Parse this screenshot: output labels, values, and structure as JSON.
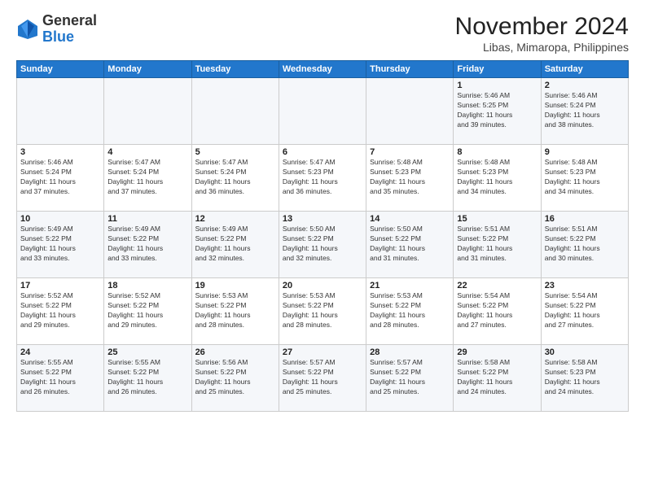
{
  "logo": {
    "general": "General",
    "blue": "Blue"
  },
  "header": {
    "month": "November 2024",
    "location": "Libas, Mimaropa, Philippines"
  },
  "weekdays": [
    "Sunday",
    "Monday",
    "Tuesday",
    "Wednesday",
    "Thursday",
    "Friday",
    "Saturday"
  ],
  "weeks": [
    [
      {
        "day": "",
        "info": ""
      },
      {
        "day": "",
        "info": ""
      },
      {
        "day": "",
        "info": ""
      },
      {
        "day": "",
        "info": ""
      },
      {
        "day": "",
        "info": ""
      },
      {
        "day": "1",
        "info": "Sunrise: 5:46 AM\nSunset: 5:25 PM\nDaylight: 11 hours\nand 39 minutes."
      },
      {
        "day": "2",
        "info": "Sunrise: 5:46 AM\nSunset: 5:24 PM\nDaylight: 11 hours\nand 38 minutes."
      }
    ],
    [
      {
        "day": "3",
        "info": "Sunrise: 5:46 AM\nSunset: 5:24 PM\nDaylight: 11 hours\nand 37 minutes."
      },
      {
        "day": "4",
        "info": "Sunrise: 5:47 AM\nSunset: 5:24 PM\nDaylight: 11 hours\nand 37 minutes."
      },
      {
        "day": "5",
        "info": "Sunrise: 5:47 AM\nSunset: 5:24 PM\nDaylight: 11 hours\nand 36 minutes."
      },
      {
        "day": "6",
        "info": "Sunrise: 5:47 AM\nSunset: 5:23 PM\nDaylight: 11 hours\nand 36 minutes."
      },
      {
        "day": "7",
        "info": "Sunrise: 5:48 AM\nSunset: 5:23 PM\nDaylight: 11 hours\nand 35 minutes."
      },
      {
        "day": "8",
        "info": "Sunrise: 5:48 AM\nSunset: 5:23 PM\nDaylight: 11 hours\nand 34 minutes."
      },
      {
        "day": "9",
        "info": "Sunrise: 5:48 AM\nSunset: 5:23 PM\nDaylight: 11 hours\nand 34 minutes."
      }
    ],
    [
      {
        "day": "10",
        "info": "Sunrise: 5:49 AM\nSunset: 5:22 PM\nDaylight: 11 hours\nand 33 minutes."
      },
      {
        "day": "11",
        "info": "Sunrise: 5:49 AM\nSunset: 5:22 PM\nDaylight: 11 hours\nand 33 minutes."
      },
      {
        "day": "12",
        "info": "Sunrise: 5:49 AM\nSunset: 5:22 PM\nDaylight: 11 hours\nand 32 minutes."
      },
      {
        "day": "13",
        "info": "Sunrise: 5:50 AM\nSunset: 5:22 PM\nDaylight: 11 hours\nand 32 minutes."
      },
      {
        "day": "14",
        "info": "Sunrise: 5:50 AM\nSunset: 5:22 PM\nDaylight: 11 hours\nand 31 minutes."
      },
      {
        "day": "15",
        "info": "Sunrise: 5:51 AM\nSunset: 5:22 PM\nDaylight: 11 hours\nand 31 minutes."
      },
      {
        "day": "16",
        "info": "Sunrise: 5:51 AM\nSunset: 5:22 PM\nDaylight: 11 hours\nand 30 minutes."
      }
    ],
    [
      {
        "day": "17",
        "info": "Sunrise: 5:52 AM\nSunset: 5:22 PM\nDaylight: 11 hours\nand 29 minutes."
      },
      {
        "day": "18",
        "info": "Sunrise: 5:52 AM\nSunset: 5:22 PM\nDaylight: 11 hours\nand 29 minutes."
      },
      {
        "day": "19",
        "info": "Sunrise: 5:53 AM\nSunset: 5:22 PM\nDaylight: 11 hours\nand 28 minutes."
      },
      {
        "day": "20",
        "info": "Sunrise: 5:53 AM\nSunset: 5:22 PM\nDaylight: 11 hours\nand 28 minutes."
      },
      {
        "day": "21",
        "info": "Sunrise: 5:53 AM\nSunset: 5:22 PM\nDaylight: 11 hours\nand 28 minutes."
      },
      {
        "day": "22",
        "info": "Sunrise: 5:54 AM\nSunset: 5:22 PM\nDaylight: 11 hours\nand 27 minutes."
      },
      {
        "day": "23",
        "info": "Sunrise: 5:54 AM\nSunset: 5:22 PM\nDaylight: 11 hours\nand 27 minutes."
      }
    ],
    [
      {
        "day": "24",
        "info": "Sunrise: 5:55 AM\nSunset: 5:22 PM\nDaylight: 11 hours\nand 26 minutes."
      },
      {
        "day": "25",
        "info": "Sunrise: 5:55 AM\nSunset: 5:22 PM\nDaylight: 11 hours\nand 26 minutes."
      },
      {
        "day": "26",
        "info": "Sunrise: 5:56 AM\nSunset: 5:22 PM\nDaylight: 11 hours\nand 25 minutes."
      },
      {
        "day": "27",
        "info": "Sunrise: 5:57 AM\nSunset: 5:22 PM\nDaylight: 11 hours\nand 25 minutes."
      },
      {
        "day": "28",
        "info": "Sunrise: 5:57 AM\nSunset: 5:22 PM\nDaylight: 11 hours\nand 25 minutes."
      },
      {
        "day": "29",
        "info": "Sunrise: 5:58 AM\nSunset: 5:22 PM\nDaylight: 11 hours\nand 24 minutes."
      },
      {
        "day": "30",
        "info": "Sunrise: 5:58 AM\nSunset: 5:23 PM\nDaylight: 11 hours\nand 24 minutes."
      }
    ]
  ]
}
